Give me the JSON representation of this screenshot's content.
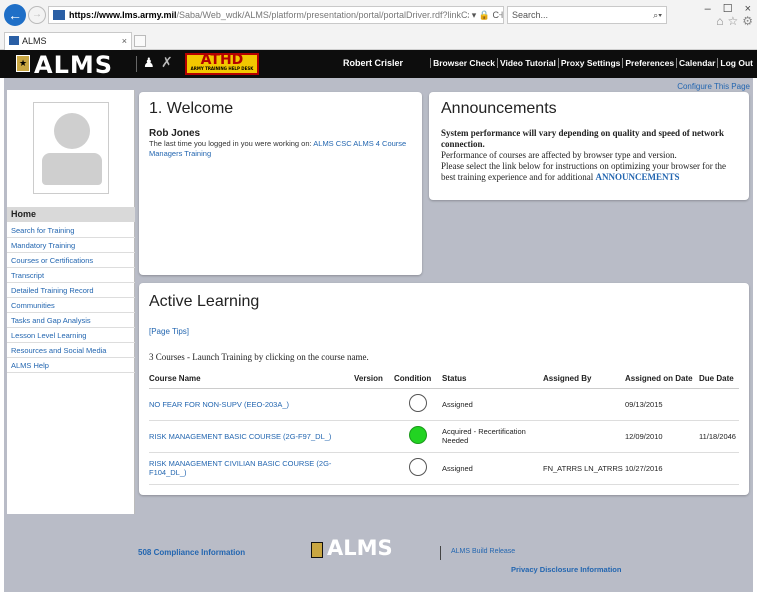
{
  "browser": {
    "url_host": "https://www.lms.army.mil",
    "url_path": "/Saba/Web_wdk/ALMS/platform/presentation/portal/portalDriver.rdf?linkCxt=My_Home&portal=my:",
    "url_controls": "▾ 🔒 C",
    "search_placeholder": "Search...",
    "search_icon": "⌕▾",
    "tab_title": "ALMS",
    "tab_close": "×",
    "window_buttons": [
      "–",
      "☐",
      "×"
    ],
    "toolbar_icons": [
      "⌂",
      "☆",
      "⚙"
    ]
  },
  "header": {
    "logo_text": "ALMS",
    "athd_text": "ATHD",
    "athd_subtext": "ARMY TRAINING HELP DESK",
    "user_name": "Robert Crisler",
    "links": [
      "Browser Check",
      "Video Tutorial",
      "Proxy Settings",
      "Preferences",
      "Calendar",
      "Log Out"
    ]
  },
  "configure_link": "Configure This Page",
  "sidebar": {
    "home": "Home",
    "items": [
      "Search for Training",
      "Mandatory Training",
      "Courses or Certifications",
      "Transcript",
      "Detailed Training Record",
      "Communities",
      "Tasks and Gap Analysis",
      "Lesson Level Learning",
      "Resources and Social Media",
      "ALMS Help"
    ]
  },
  "welcome": {
    "title": "1. Welcome",
    "name": "Rob Jones",
    "last_prefix": "The last time you logged in you were working on: ",
    "last_link": "ALMS CSC ALMS 4 Course Managers Training"
  },
  "announcements": {
    "title": "Announcements",
    "bold": "System performance will vary depending on quality and speed of network connection.",
    "line1": "Performance of courses are affected by browser type and version.",
    "line2": "Please select the link below for instructions on optimizing your browser for the best training experience and for additional ",
    "link": "ANNOUNCEMENTS"
  },
  "active_learning": {
    "title": "Active Learning",
    "tips": "[Page Tips]",
    "count_text": "3 Courses - Launch Training by clicking on the course name.",
    "columns": [
      "Course Name",
      "Version",
      "Condition",
      "Status",
      "Assigned By",
      "Assigned on Date",
      "Due Date"
    ],
    "rows": [
      {
        "name": "NO FEAR FOR NON-SUPV (EEO-203A_)",
        "version": "",
        "condition": "empty",
        "status": "Assigned",
        "assigned_by": "",
        "assigned_on": "09/13/2015",
        "due": ""
      },
      {
        "name": "RISK MANAGEMENT BASIC COURSE (2G-F97_DL_)",
        "version": "",
        "condition": "green",
        "status": "Acquired - Recertification Needed",
        "assigned_by": "",
        "assigned_on": "12/09/2010",
        "due": "11/18/2046"
      },
      {
        "name": "RISK MANAGEMENT CIVILIAN BASIC COURSE (2G-F104_DL_)",
        "version": "",
        "condition": "empty",
        "status": "Assigned",
        "assigned_by": "FN_ATRRS LN_ATRRS",
        "assigned_on": "10/27/2016",
        "due": ""
      }
    ],
    "condition_colors": {
      "green": "#22d322"
    }
  },
  "footer": {
    "compliance": "508 Compliance Information",
    "logo_text": "ALMS",
    "build": "ALMS Build Release",
    "privacy": "Privacy Disclosure Information"
  }
}
